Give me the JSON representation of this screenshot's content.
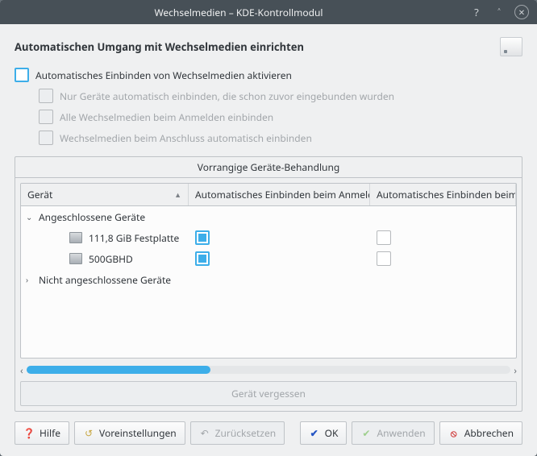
{
  "window": {
    "title": "Wechselmedien – KDE-Kontrollmodul"
  },
  "header": {
    "title": "Automatischen Umgang mit Wechselmedien einrichten"
  },
  "options": {
    "enable": "Automatisches Einbinden von Wechselmedien aktivieren",
    "only_known": "Nur Geräte automatisch einbinden, die schon zuvor eingebunden wurden",
    "on_login": "Alle Wechselmedien beim Anmelden einbinden",
    "on_attach": "Wechselmedien beim Anschluss automatisch einbinden"
  },
  "panel": {
    "title": "Vorrangige Geräte-Behandlung",
    "col_device": "Gerät",
    "col_login": "Automatisches Einbinden beim Anmelden",
    "col_attach": "Automatisches Einbinden beim Anscl",
    "group_attached": "Angeschlossene Geräte",
    "group_detached": "Nicht angeschlossene Geräte",
    "devices": [
      {
        "name": "111,8 GiB Festplatte",
        "login": true,
        "attach": false
      },
      {
        "name": "500GBHD",
        "login": true,
        "attach": false
      }
    ],
    "forget": "Gerät vergessen"
  },
  "buttons": {
    "help": "Hilfe",
    "defaults": "Voreinstellungen",
    "reset": "Zurücksetzen",
    "ok": "OK",
    "apply": "Anwenden",
    "cancel": "Abbrechen"
  }
}
